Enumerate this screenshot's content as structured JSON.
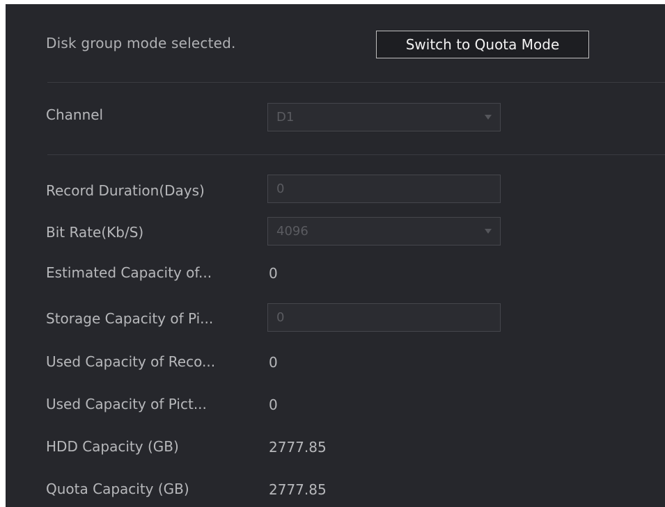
{
  "header": {
    "mode_text": "Disk group mode selected.",
    "switch_button": "Switch to Quota Mode"
  },
  "channel": {
    "label": "Channel",
    "value": "D1"
  },
  "rows": {
    "record_duration": {
      "label": "Record Duration(Days)",
      "value": "0"
    },
    "bit_rate": {
      "label": "Bit Rate(Kb/S)",
      "value": "4096"
    },
    "estimated_capacity": {
      "label": "Estimated Capacity of...",
      "value": "0"
    },
    "storage_capacity_picture": {
      "label": "Storage Capacity of Pi...",
      "value": "0"
    },
    "used_capacity_record": {
      "label": "Used Capacity of Reco...",
      "value": "0"
    },
    "used_capacity_picture": {
      "label": "Used Capacity of Pict...",
      "value": "0"
    },
    "hdd_capacity": {
      "label": "HDD Capacity (GB)",
      "value": "2777.85"
    },
    "quota_capacity": {
      "label": "Quota Capacity (GB)",
      "value": "2777.85"
    }
  }
}
